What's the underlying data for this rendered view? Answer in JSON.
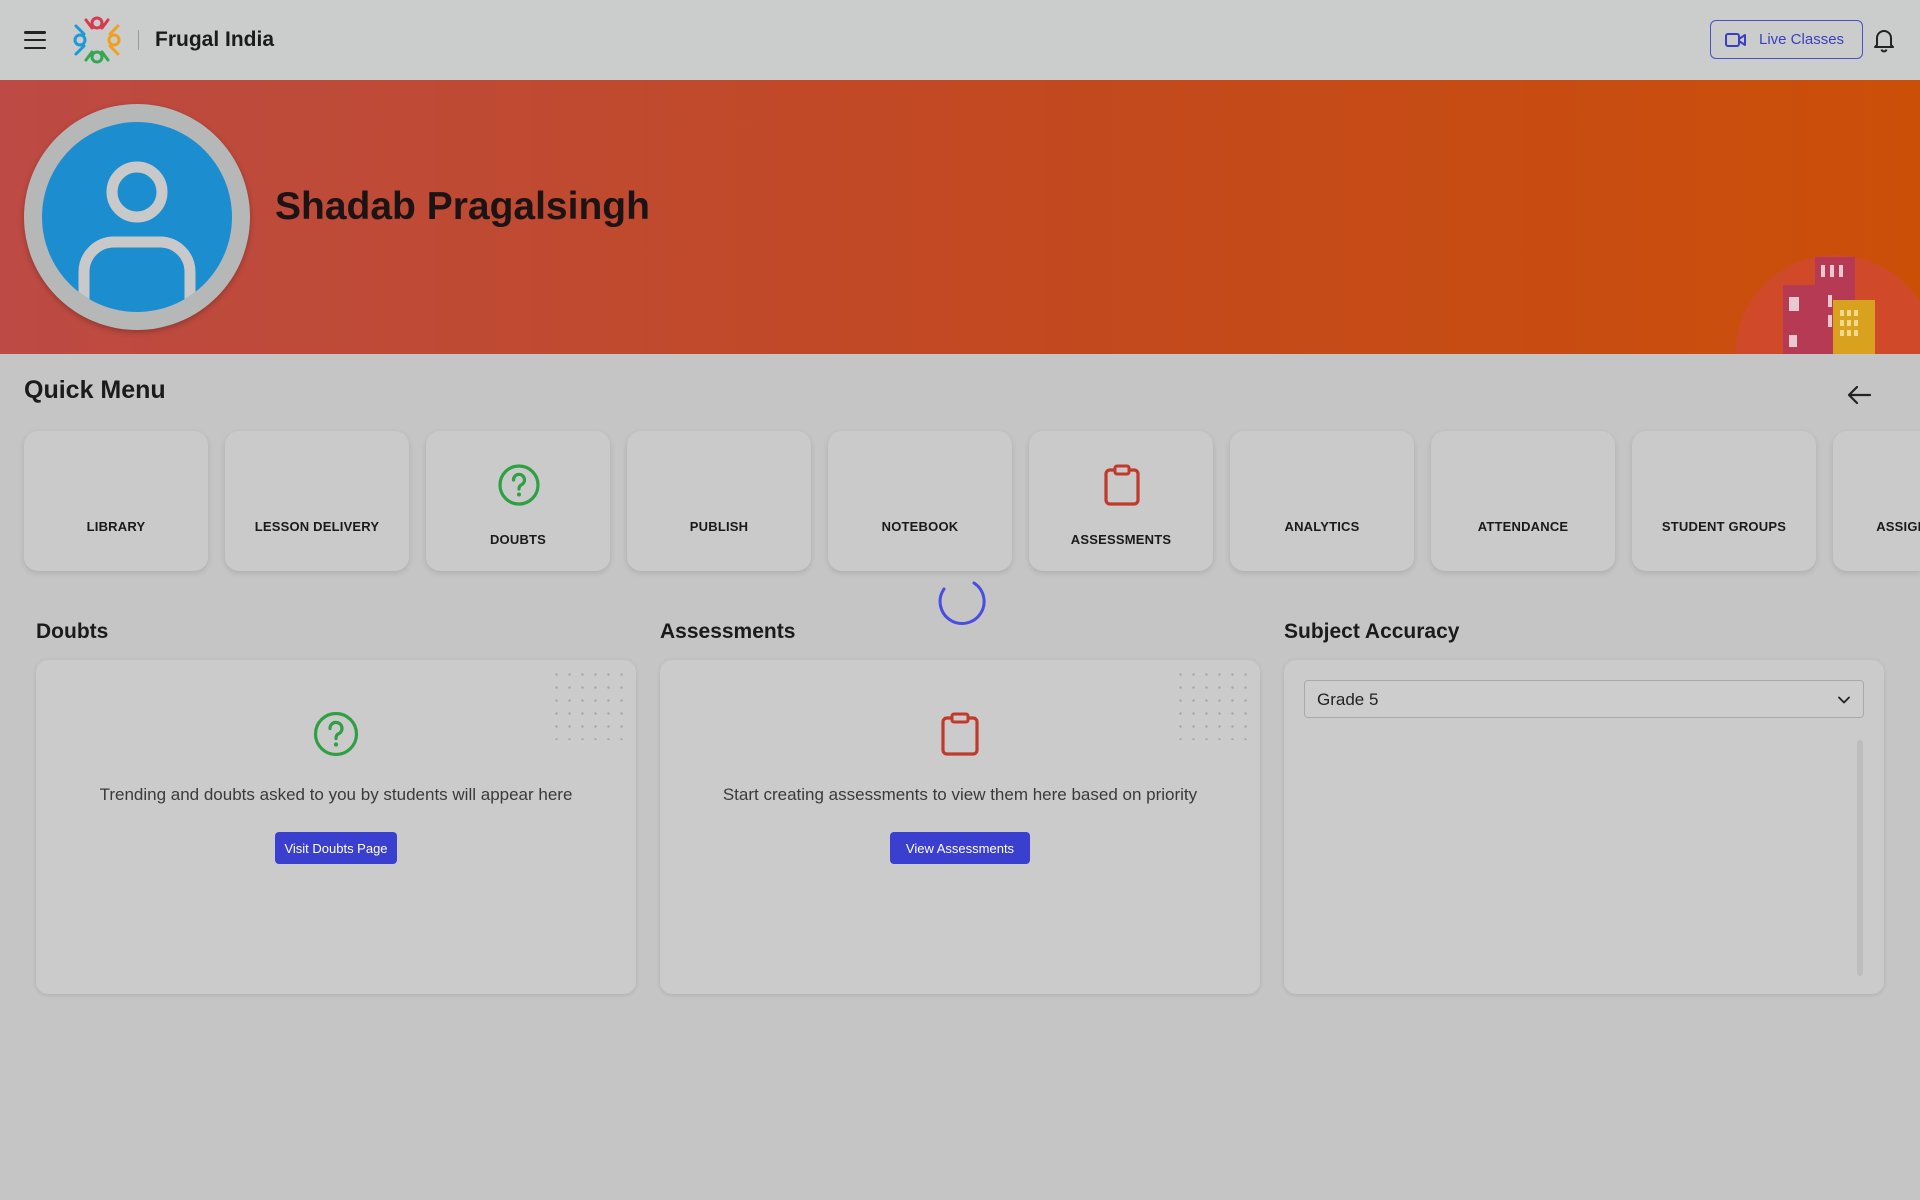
{
  "header": {
    "brand": "Frugal India",
    "live_classes_label": "Live Classes",
    "icons": [
      "menu-icon",
      "video-camera-icon",
      "bell-icon"
    ]
  },
  "profile": {
    "name": "Shadab Pragalsingh"
  },
  "quick_menu": {
    "title": "Quick Menu",
    "items": [
      {
        "label": "LIBRARY"
      },
      {
        "label": "LESSON DELIVERY"
      },
      {
        "label": "DOUBTS",
        "icon": "question-circle-icon"
      },
      {
        "label": "PUBLISH"
      },
      {
        "label": "NOTEBOOK"
      },
      {
        "label": "ASSESSMENTS",
        "icon": "clipboard-icon"
      },
      {
        "label": "ANALYTICS"
      },
      {
        "label": "ATTENDANCE"
      },
      {
        "label": "STUDENT GROUPS"
      },
      {
        "label": "ASSIGNMENTS"
      }
    ]
  },
  "widgets": {
    "doubts": {
      "title": "Doubts",
      "message": "Trending and doubts asked to you by students will appear here",
      "button": "Visit Doubts Page"
    },
    "assessments": {
      "title": "Assessments",
      "message": "Start creating assessments to view them here based on priority",
      "button": "View Assessments"
    },
    "subject_accuracy": {
      "title": "Subject Accuracy",
      "selected_grade": "Grade 5"
    }
  },
  "colors": {
    "accent": "#3a3fd0",
    "doubts_green": "#2ea043",
    "assessments_red": "#c0392b",
    "banner_start": "#bd4a44",
    "banner_end": "#cc4f08"
  }
}
